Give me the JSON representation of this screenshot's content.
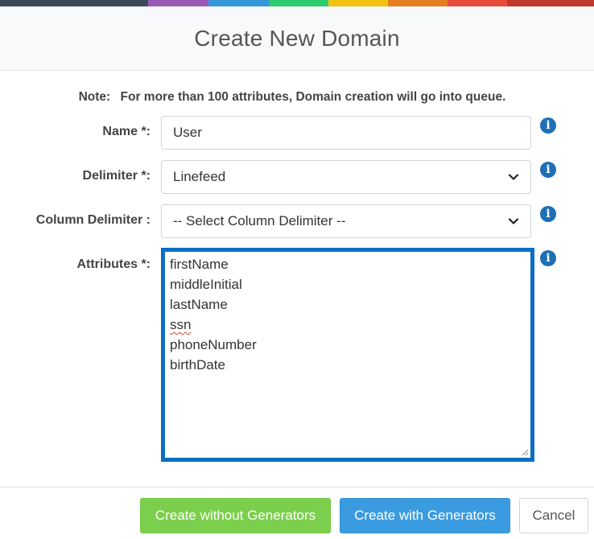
{
  "top_strip": {
    "colors": [
      "#3b4a5a",
      "#9b59b6",
      "#3498db",
      "#2ecc71",
      "#f1c40f",
      "#e67e22",
      "#e74c3c",
      "#c0392b"
    ]
  },
  "dialog": {
    "title": "Create New Domain"
  },
  "note": {
    "label": "Note:",
    "text": "For more than 100 attributes, Domain creation will go into queue."
  },
  "form": {
    "name": {
      "label": "Name *:",
      "value": "User"
    },
    "delimiter": {
      "label": "Delimiter *:",
      "value": "Linefeed"
    },
    "column_delimiter": {
      "label": "Column Delimiter :",
      "value": "-- Select Column Delimiter --"
    },
    "attributes": {
      "label": "Attributes *:",
      "lines": [
        "firstName",
        "middleInitial",
        "lastName",
        "ssn",
        "phoneNumber",
        "birthDate"
      ]
    },
    "info_icon_glyph": "i"
  },
  "icons": {
    "info": "info-circle-icon",
    "chevron": "chevron-down-icon",
    "resize": "resize-grip-icon"
  },
  "colors": {
    "accent_blue": "#3a9be0",
    "accent_green": "#7ccf4c",
    "focus_border": "#0b6fc3",
    "info_icon": "#1f6fb5"
  },
  "footer": {
    "create_without_label": "Create without Generators",
    "create_with_label": "Create with Generators",
    "cancel_label": "Cancel"
  }
}
